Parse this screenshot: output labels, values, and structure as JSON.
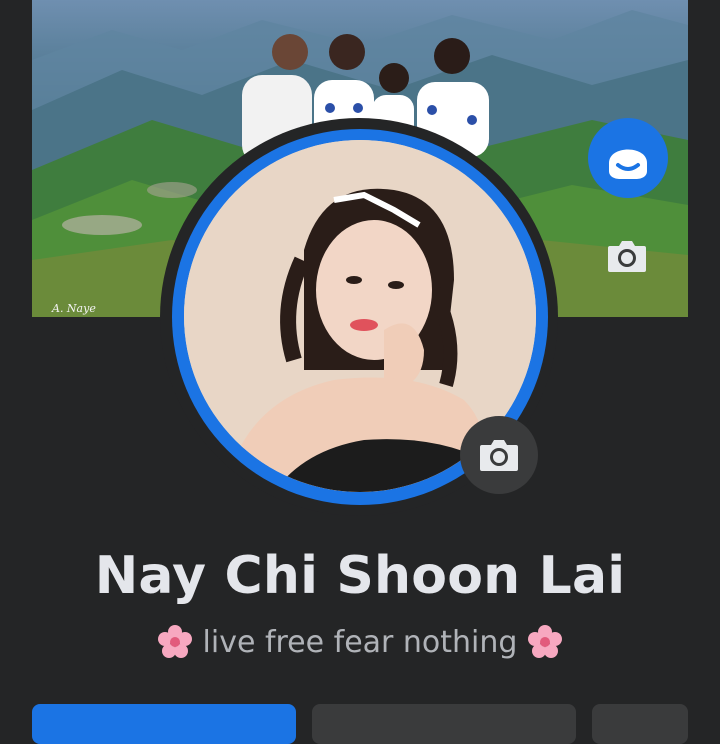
{
  "profile": {
    "name": "Nay Chi Shoon Lai",
    "bio": "live free fear nothing",
    "cover_signature": "A. Naye"
  },
  "icons": {
    "cover_camera": "camera-icon",
    "profile_camera": "camera-icon",
    "avatar_badge": "avatar-icon",
    "bio_emoji": "cherry-blossom-icon"
  },
  "colors": {
    "background": "#242526",
    "accent": "#1b74e4",
    "name_text": "#e4e6eb",
    "bio_text": "#b0b3b8",
    "secondary_button": "#3a3b3c"
  },
  "actions": {
    "primary_button": "",
    "secondary_button": "",
    "more_button": ""
  }
}
